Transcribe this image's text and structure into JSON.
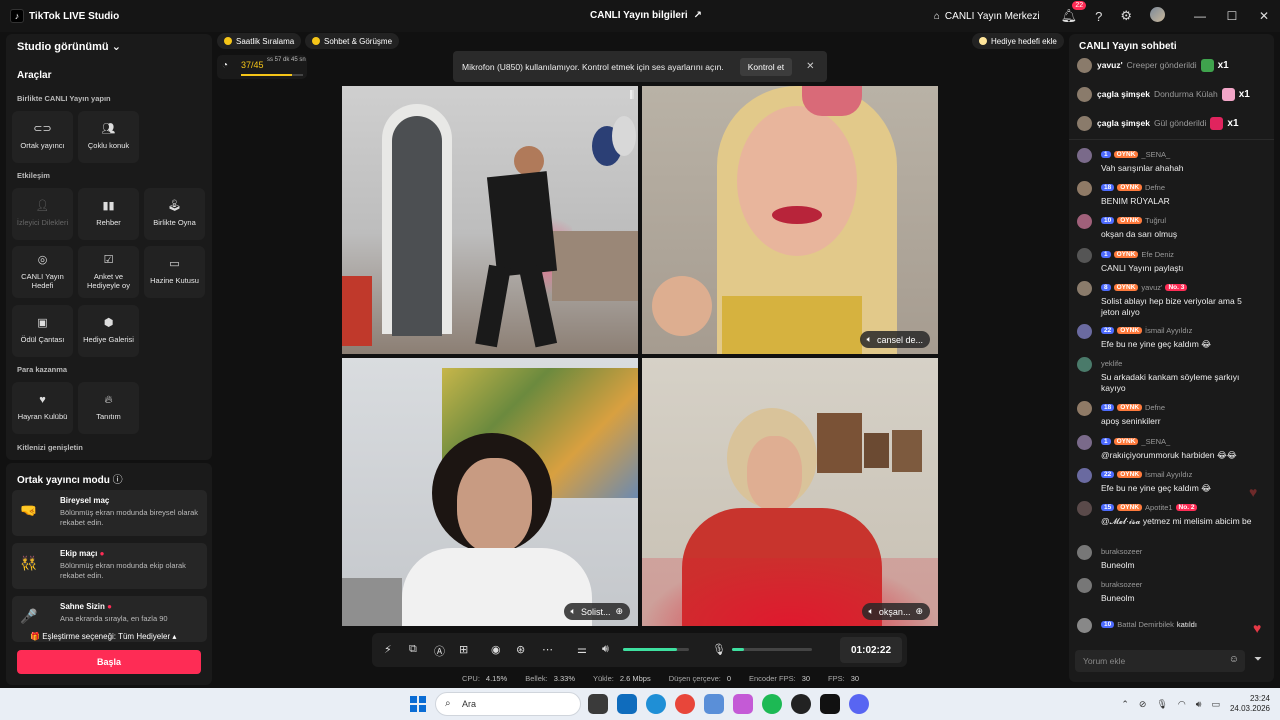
{
  "titlebar": {
    "app_title": "TikTok LIVE Studio",
    "center_title": "CANLI Yayın bilgileri",
    "center_right": "CANLI Yayın Merkezi",
    "notif_count": "22"
  },
  "left_panel": {
    "header": "Studio görünümü",
    "tools_title": "Araçlar",
    "section_together": "Birlikte CANLI Yayın yapın",
    "section_engage": "Etkileşim",
    "section_money": "Para kazanma",
    "section_grow": "Kitlenizi genişletin",
    "tools": {
      "cohost": "Ortak yayıncı",
      "multi_guest": "Çoklu konuk",
      "viewer_requests": "İzleyici Dilekleri",
      "guide": "Rehber",
      "play_together": "Birlikte Oyna",
      "live_goal": "CANLI Yayın Hedefi",
      "poll": "Anket ve Hediyeyle oy",
      "treasure": "Hazine Kutusu",
      "reward_bag": "Ödül Çantası",
      "gift_gallery": "Hediye Galerisi",
      "fan_club": "Hayran Kulübü",
      "promote": "Tanıtım"
    }
  },
  "coop": {
    "header": "Ortak yayıncı modu",
    "modes": [
      {
        "title": "Bireysel maç",
        "desc": "Bölünmüş ekran modunda bireysel olarak rekabet edin."
      },
      {
        "title": "Ekip maçı",
        "desc": "Bölünmüş ekran modunda ekip olarak rekabet edin."
      },
      {
        "title": "Sahne Sizin",
        "desc": "Ana ekranda sırayla, en fazla 90"
      }
    ],
    "match_option": "Eşleştirme seçeneği: Tüm Hediyeler",
    "start": "Başla"
  },
  "center": {
    "chip_hourly": "Saatlik Sıralama",
    "chip_chat": "Sohbet & Görüşme",
    "chip_gift_goal": "Hediye hedefi ekle",
    "goal_value": "37/45",
    "goal_progress": 0.82,
    "goal_time": "ss 57 dk 45 sn",
    "toast_msg": "Mikrofon (U850) kullanılamıyor. Kontrol etmek için ses ayarlarını açın.",
    "toast_btn": "Kontrol et",
    "tiles": {
      "tr": "cansel de...",
      "bl": "Solist...",
      "br": "okşan..."
    },
    "timer": "01:02:22",
    "volume": 0.82,
    "mic": 0.15,
    "stats": [
      {
        "label": "CPU:",
        "value": "4.15%"
      },
      {
        "label": "Bellek:",
        "value": "3.33%"
      },
      {
        "label": "Yükle:",
        "value": "2.6 Mbps"
      },
      {
        "label": "Düşen çerçeve:",
        "value": "0"
      },
      {
        "label": "Encoder FPS:",
        "value": "30"
      },
      {
        "label": "FPS:",
        "value": "30"
      }
    ]
  },
  "chat": {
    "header": "CANLI Yayın sohbeti",
    "gifts": [
      {
        "name": "yavuz'",
        "action": "Creeper gönderildi",
        "count": "x1",
        "color": "#3fa34d"
      },
      {
        "name": "çagla şimşek",
        "action": "Dondurma Külah",
        "count": "x1",
        "color": "#f3a6c8"
      },
      {
        "name": "çagla şimşek",
        "action": "Gül gönderildi",
        "count": "x1",
        "color": "#e0245e"
      }
    ],
    "messages": [
      {
        "lvl": "1",
        "fan": "OYNK",
        "user": "_SENA_",
        "rank": "",
        "text": "Vah sarışınlar ahahah"
      },
      {
        "lvl": "18",
        "fan": "OYNK",
        "user": "Defne",
        "rank": "",
        "text": "BENIM RÜYALAR"
      },
      {
        "lvl": "10",
        "fan": "OYNK",
        "user": "Tuğrul",
        "rank": "",
        "text": "okşan da sarı olmuş"
      },
      {
        "lvl": "1",
        "fan": "OYNK",
        "user": "Efe Deniz",
        "rank": "",
        "text": "CANLI Yayını paylaştı"
      },
      {
        "lvl": "8",
        "fan": "OYNK",
        "user": "yavuz'",
        "rank": "No. 3",
        "text": "Solist ablayı hep bize veriyolar ama 5 jeton alıyo"
      },
      {
        "lvl": "22",
        "fan": "OYNK",
        "user": "İsmail Ayyıldız",
        "rank": "",
        "text": "Efe bu ne yine geç kaldım 😂"
      },
      {
        "lvl": "",
        "fan": "",
        "user": "yeklife",
        "rank": "",
        "text": "Su arkadaki kankam söyleme şarkıyı kayıyo"
      },
      {
        "lvl": "18",
        "fan": "OYNK",
        "user": "Defne",
        "rank": "",
        "text": "apoş seninkilerr"
      },
      {
        "lvl": "1",
        "fan": "OYNK",
        "user": "_SENA_",
        "rank": "",
        "text": "@rakıiçiyorummoruk harbiden 😂😂"
      },
      {
        "lvl": "22",
        "fan": "OYNK",
        "user": "İsmail Ayyıldız",
        "rank": "",
        "text": "Efe bu ne yine geç kaldım 😂"
      },
      {
        "lvl": "15",
        "fan": "OYNK",
        "user": "Apotite1",
        "rank": "No. 2",
        "text": "@𝓜𝓮𝓵·𝓲𝓼𝓪 yetmez mi melisim abicim be"
      },
      {
        "lvl": "",
        "fan": "",
        "user": "buraksozeer",
        "rank": "",
        "text": "Buneolm"
      },
      {
        "lvl": "",
        "fan": "",
        "user": "buraksozeer",
        "rank": "",
        "text": "Buneolm"
      },
      {
        "lvl": "10",
        "fan": "",
        "user": "Battal Demirbilek",
        "rank": "",
        "text": "katıldı"
      }
    ],
    "input_placeholder": "Yorum ekle"
  },
  "taskbar": {
    "search": "Ara",
    "time": "23:24",
    "date": "24.03.2026"
  }
}
